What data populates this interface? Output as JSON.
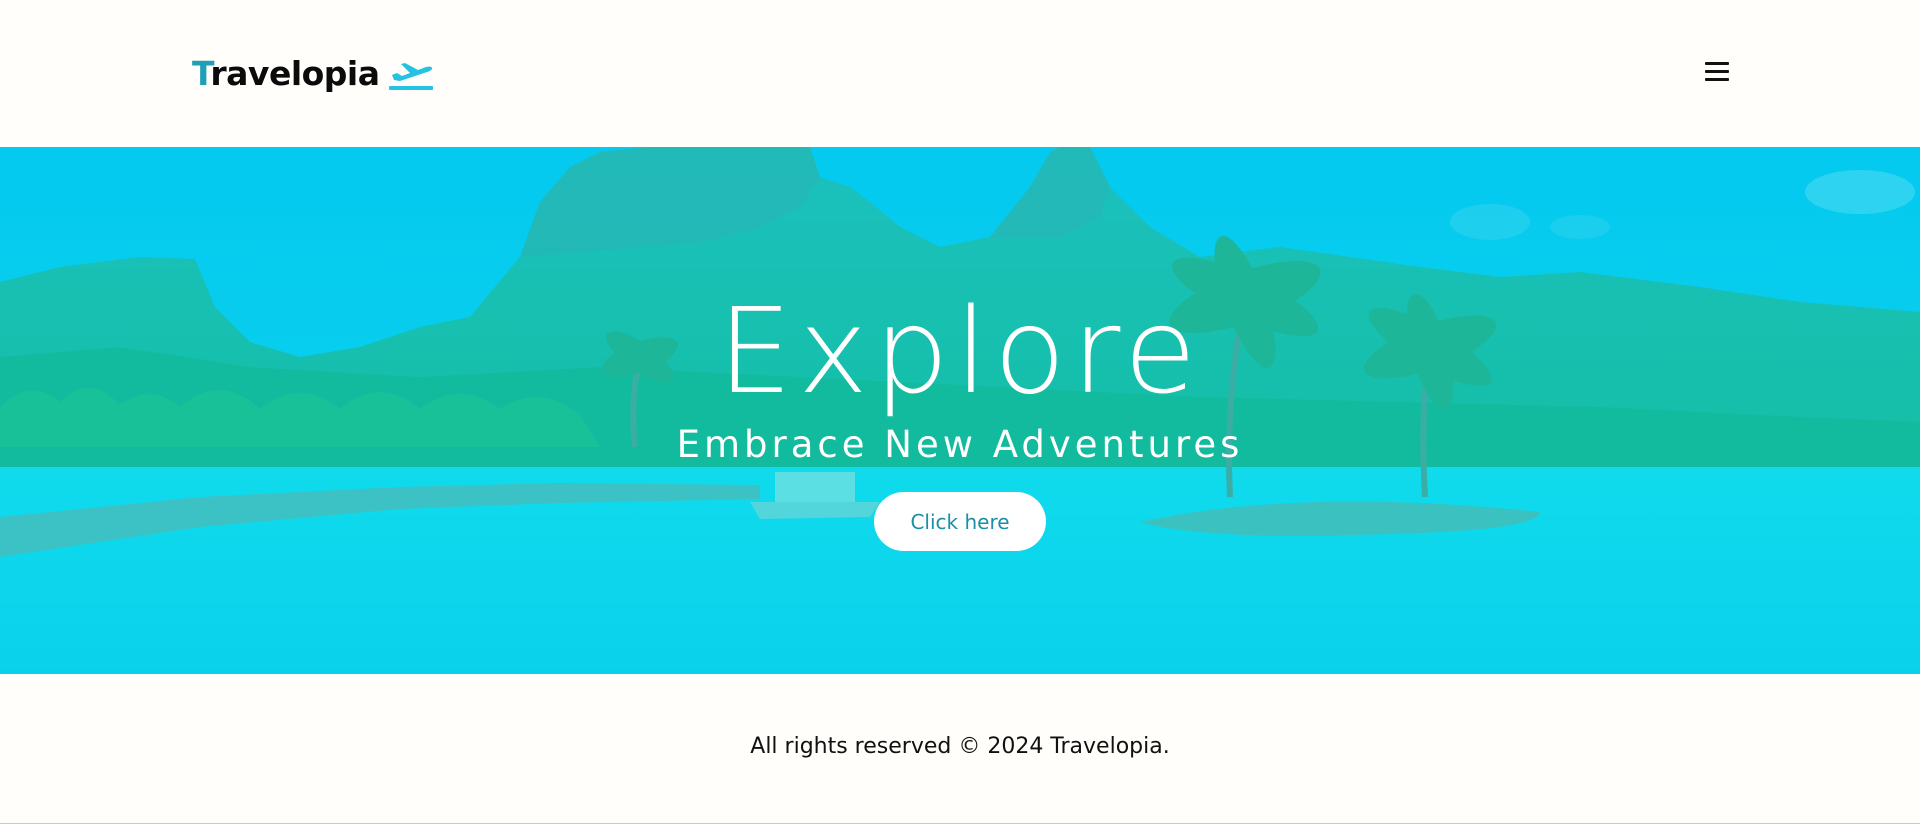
{
  "brand": {
    "first_letter": "T",
    "rest": "ravelopia",
    "icon": "airplane-icon",
    "accent_color": "#1e9fb6"
  },
  "header": {
    "menu_icon": "hamburger-menu-icon"
  },
  "hero": {
    "title": "Explore",
    "subtitle": "Embrace New Adventures",
    "cta_label": "Click here",
    "overlay_color": "#00d0ee"
  },
  "footer": {
    "text": "All rights reserved © 2024 Travelopia."
  }
}
